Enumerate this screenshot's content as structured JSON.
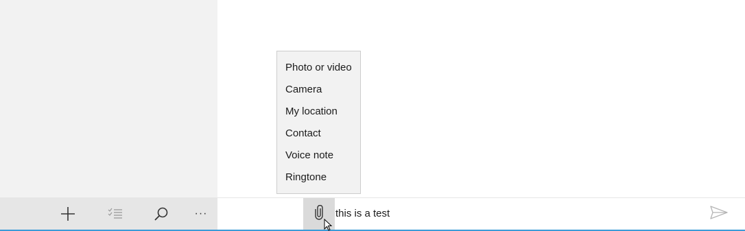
{
  "attach_menu": {
    "items": [
      {
        "label": "Photo or video"
      },
      {
        "label": "Camera"
      },
      {
        "label": "My location"
      },
      {
        "label": "Contact"
      },
      {
        "label": "Voice note"
      },
      {
        "label": "Ringtone"
      }
    ]
  },
  "toolbar": {
    "buttons": [
      {
        "icon": "plus-icon"
      },
      {
        "icon": "select-list-icon"
      },
      {
        "icon": "search-icon"
      },
      {
        "icon": "more-icon",
        "label": "···"
      }
    ]
  },
  "compose": {
    "attach_icon": "paperclip-icon",
    "text": "this is a test",
    "send_icon": "send-icon"
  },
  "colors": {
    "accent": "#3a9bd8",
    "pane_bg": "#f2f2f2",
    "toolbar_bg": "#e6e6e6"
  }
}
